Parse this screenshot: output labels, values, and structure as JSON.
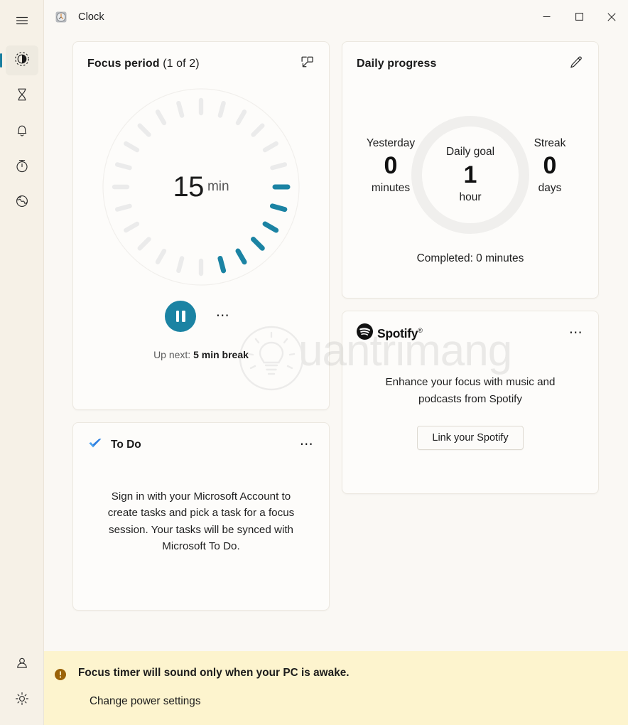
{
  "window": {
    "app_icon": "alarm-clock-icon",
    "title": "Clock",
    "minimize": "─",
    "maximize": "□",
    "close": "✕"
  },
  "sidebar": {
    "hamburger": "hamburger-menu-icon",
    "items": [
      {
        "name": "focus-sessions",
        "icon": "focus-sessions-icon",
        "selected": true
      },
      {
        "name": "timer",
        "icon": "hourglass-timer-icon",
        "selected": false
      },
      {
        "name": "alarm",
        "icon": "bell-alarm-icon",
        "selected": false
      },
      {
        "name": "stopwatch",
        "icon": "stopwatch-icon",
        "selected": false
      },
      {
        "name": "world-clock",
        "icon": "globe-world-clock-icon",
        "selected": false
      }
    ],
    "bottom": [
      {
        "name": "account",
        "icon": "person-account-icon"
      },
      {
        "name": "settings",
        "icon": "gear-settings-icon"
      }
    ]
  },
  "focus_card": {
    "title": "Focus period",
    "subtitle": "(1 of 2)",
    "mini_view_icon": "open-mini-view-icon",
    "timer_value": "15",
    "timer_unit": "min",
    "total_ticks": 24,
    "active_ticks": 6,
    "accent_color": "#1b83a3",
    "tick_color": "#ebebeb",
    "play_pause_icon": "pause-icon",
    "more_options_icon": "more-options-icon",
    "up_next_prefix": "Up next: ",
    "up_next_value": "5 min break"
  },
  "todo_card": {
    "icon": "to-do-checkmark-icon",
    "title": "To Do",
    "more_options_icon": "more-options-icon",
    "body": "Sign in with your Microsoft Account to create tasks and pick a task for a focus session. Your tasks will be synced with Microsoft To Do."
  },
  "progress_card": {
    "title": "Daily progress",
    "edit_icon": "edit-pencil-icon",
    "yesterday": {
      "label": "Yesterday",
      "value": "0",
      "unit": "minutes"
    },
    "daily_goal": {
      "label": "Daily goal",
      "value": "1",
      "unit": "hour"
    },
    "streak": {
      "label": "Streak",
      "value": "0",
      "unit": "days"
    },
    "completed": "Completed: 0 minutes",
    "ring_color": "#f0efed",
    "ring_progress_percent": 0
  },
  "spotify_card": {
    "logo_icon": "spotify-logo-icon",
    "name": "Spotify",
    "trademark": "®",
    "more_options_icon": "more-options-icon",
    "body": "Enhance your focus with music and podcasts from Spotify",
    "button": "Link your Spotify"
  },
  "warning_bar": {
    "icon": "warning-exclamation-icon",
    "message": "Focus timer will sound only when your PC is awake.",
    "link": "Change power settings",
    "background_color": "#fdf4ce",
    "icon_color": "#9a6208"
  },
  "watermark": {
    "text": "uantrimang",
    "logo": "lightbulb-logo-icon"
  }
}
